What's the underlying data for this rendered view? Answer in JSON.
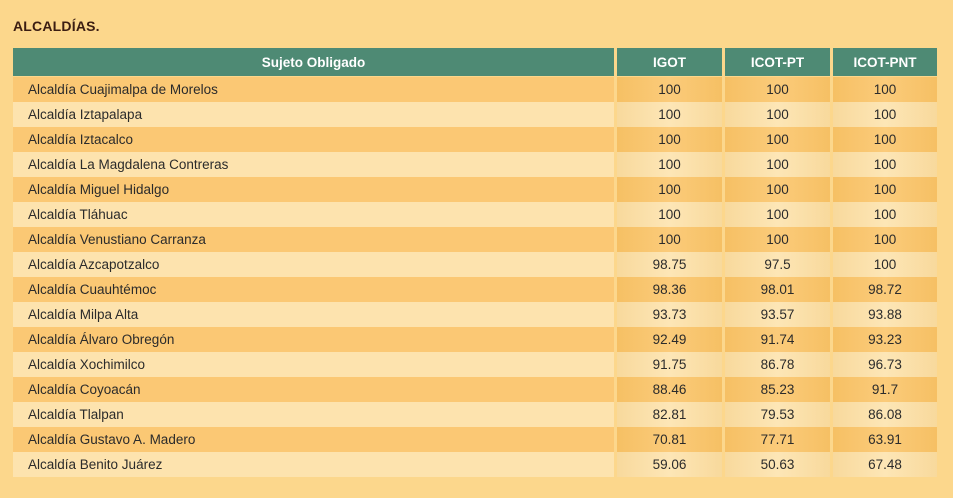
{
  "title": "ALCALDÍAS.",
  "table": {
    "headers": [
      "Sujeto Obligado",
      "IGOT",
      "ICOT-PT",
      "ICOT-PNT"
    ],
    "rows": [
      [
        "Alcaldía Cuajimalpa de Morelos",
        "100",
        "100",
        "100"
      ],
      [
        "Alcaldía Iztapalapa",
        "100",
        "100",
        "100"
      ],
      [
        "Alcaldía Iztacalco",
        "100",
        "100",
        "100"
      ],
      [
        "Alcaldía La Magdalena Contreras",
        "100",
        "100",
        "100"
      ],
      [
        "Alcaldía Miguel Hidalgo",
        "100",
        "100",
        "100"
      ],
      [
        "Alcaldía Tláhuac",
        "100",
        "100",
        "100"
      ],
      [
        "Alcaldía Venustiano Carranza",
        "100",
        "100",
        "100"
      ],
      [
        "Alcaldía Azcapotzalco",
        "98.75",
        "97.5",
        "100"
      ],
      [
        "Alcaldía Cuauhtémoc",
        "98.36",
        "98.01",
        "98.72"
      ],
      [
        "Alcaldía Milpa Alta",
        "93.73",
        "93.57",
        "93.88"
      ],
      [
        "Alcaldía Álvaro Obregón",
        "92.49",
        "91.74",
        "93.23"
      ],
      [
        "Alcaldía Xochimilco",
        "91.75",
        "86.78",
        "96.73"
      ],
      [
        "Alcaldía Coyoacán",
        "88.46",
        "85.23",
        "91.7"
      ],
      [
        "Alcaldía Tlalpan",
        "82.81",
        "79.53",
        "86.08"
      ],
      [
        "Alcaldía Gustavo A. Madero",
        "70.81",
        "77.71",
        "63.91"
      ],
      [
        "Alcaldía Benito Juárez",
        "59.06",
        "50.63",
        "67.48"
      ]
    ]
  }
}
